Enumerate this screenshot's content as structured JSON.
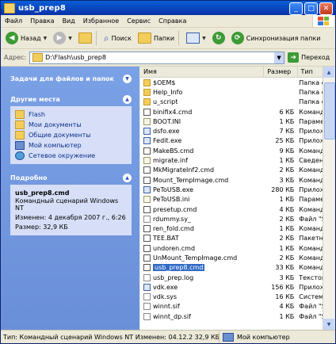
{
  "window": {
    "title": "usb_prep8"
  },
  "colors": {
    "titlebar": "#0a5fd8",
    "selection": "#316ac5",
    "taskpane": "#7aa1e6"
  },
  "menu": [
    "Файл",
    "Правка",
    "Вид",
    "Избранное",
    "Сервис",
    "Справка"
  ],
  "toolbar": {
    "back": "Назад",
    "search": "Поиск",
    "folders": "Папки",
    "sync": "Синхронизация папки"
  },
  "address": {
    "label": "Адрес:",
    "value": "D:\\Flash\\usb_prep8",
    "go": "Переход"
  },
  "tasks": {
    "file_tasks_title": "Задачи для файлов и папок",
    "other_places_title": "Другие места",
    "other_places": [
      "Flash",
      "Мои документы",
      "Общие документы",
      "Мой компьютер",
      "Сетевое окружение"
    ],
    "details_title": "Подробно",
    "details": {
      "name": "usb_prep8.cmd",
      "type": "Командный сценарий Windows NT",
      "modified": "Изменен: 4 декабря 2007 г., 6:26",
      "size": "Размер: 32,9 КБ"
    }
  },
  "columns": {
    "name": "Имя",
    "size": "Размер",
    "type": "Тип"
  },
  "files": [
    {
      "name": "$OEM$",
      "size": "",
      "type": "Папка с файл",
      "icon": "folder"
    },
    {
      "name": "Help_Info",
      "size": "",
      "type": "Папка с файл",
      "icon": "folder"
    },
    {
      "name": "u_script",
      "size": "",
      "type": "Папка с файл",
      "icon": "folder"
    },
    {
      "name": "binifix4.cmd",
      "size": "6 КБ",
      "type": "Командный с",
      "icon": "cmd"
    },
    {
      "name": "BOOT.INI",
      "size": "1 КБ",
      "type": "Параметры",
      "icon": "ini"
    },
    {
      "name": "dsfo.exe",
      "size": "7 КБ",
      "type": "Приложени",
      "icon": "exe"
    },
    {
      "name": "Fedit.exe",
      "size": "25 КБ",
      "type": "Приложени",
      "icon": "exe"
    },
    {
      "name": "MakeBS.cmd",
      "size": "9 КБ",
      "type": "Командный",
      "icon": "cmd"
    },
    {
      "name": "migrate.inf",
      "size": "1 КБ",
      "type": "Сведения д",
      "icon": "ini"
    },
    {
      "name": "MkMigrateInf2.cmd",
      "size": "2 КБ",
      "type": "Командный",
      "icon": "cmd"
    },
    {
      "name": "Mount_TempImage.cmd",
      "size": "3 КБ",
      "type": "Командный",
      "icon": "cmd"
    },
    {
      "name": "PeToUSB.exe",
      "size": "280 КБ",
      "type": "Приложени",
      "icon": "exe"
    },
    {
      "name": "PeToUSB.ini",
      "size": "1 КБ",
      "type": "Параметры",
      "icon": "ini"
    },
    {
      "name": "presetup.cmd",
      "size": "4 КБ",
      "type": "Командный",
      "icon": "cmd"
    },
    {
      "name": "rdummy.sy_",
      "size": "2 КБ",
      "type": "Файл \"SY",
      "icon": "txt"
    },
    {
      "name": "ren_fold.cmd",
      "size": "1 КБ",
      "type": "Командный",
      "icon": "cmd"
    },
    {
      "name": "TEE.BAT",
      "size": "2 КБ",
      "type": "Пакетный ф",
      "icon": "cmd"
    },
    {
      "name": "undoren.cmd",
      "size": "1 КБ",
      "type": "Командный",
      "icon": "cmd"
    },
    {
      "name": "UnMount_TempImage.cmd",
      "size": "2 КБ",
      "type": "Командный",
      "icon": "cmd"
    },
    {
      "name": "usb_prep8.cmd",
      "size": "33 КБ",
      "type": "Командный",
      "icon": "cmd",
      "selected": true
    },
    {
      "name": "usb_prep.log",
      "size": "3 КБ",
      "type": "Текстовый",
      "icon": "txt"
    },
    {
      "name": "vdk.exe",
      "size": "156 КБ",
      "type": "Приложени",
      "icon": "exe"
    },
    {
      "name": "vdk.sys",
      "size": "16 КБ",
      "type": "Системный",
      "icon": "txt"
    },
    {
      "name": "winnt.sif",
      "size": "4 КБ",
      "type": "Файл \"SIF\"",
      "icon": "txt"
    },
    {
      "name": "winnt_dp.sif",
      "size": "1 КБ",
      "type": "Файл \"SIF\"",
      "icon": "txt"
    }
  ],
  "status": {
    "left": "Тип: Командный сценарий Windows NT Изменен: 04.12.2  32,9 КБ",
    "right": "Мой компьютер"
  }
}
